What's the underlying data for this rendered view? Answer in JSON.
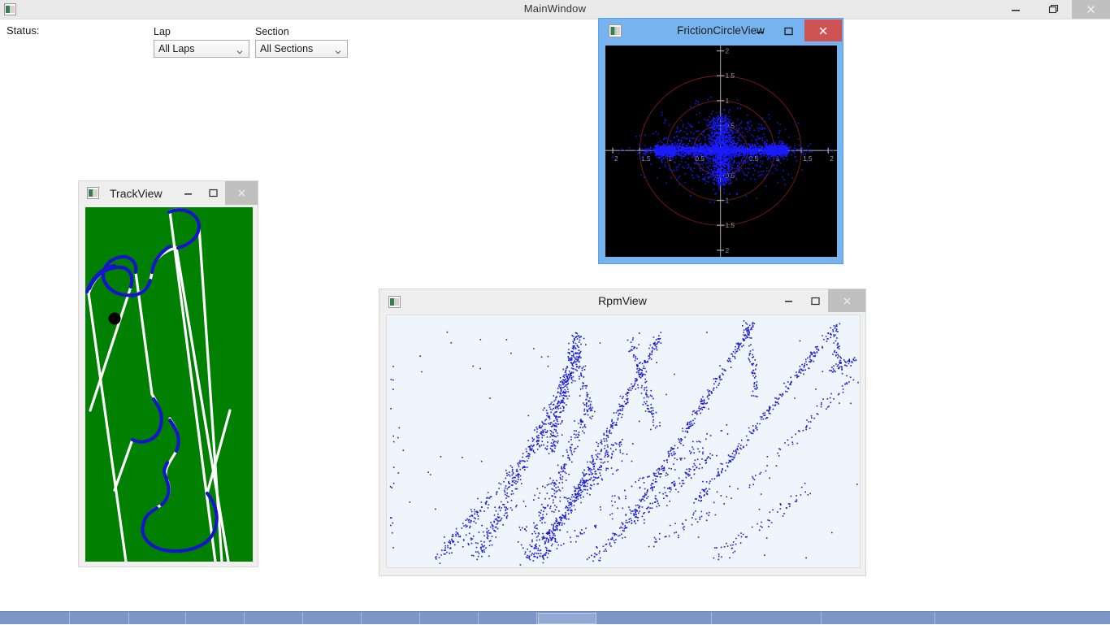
{
  "main_window": {
    "title": "MainWindow",
    "icon": "app-icon",
    "controls": {
      "minimize": "–",
      "maximize": "❐",
      "close": "×"
    }
  },
  "toolbar": {
    "status_label": "Status:",
    "status_value": "",
    "lap_filter": {
      "label": "Lap",
      "value": "All Laps",
      "options": [
        "All Laps"
      ]
    },
    "section_filter": {
      "label": "Section",
      "value": "All Sections",
      "options": [
        "All Sections"
      ]
    }
  },
  "windows": {
    "friction_circle": {
      "title": "FrictionCircleView",
      "icon": "app-icon",
      "active": true,
      "controls": {
        "minimize": "–",
        "maximize": "❐",
        "close": "×"
      },
      "colors": {
        "frame": "#76b3ef",
        "plot_background": "#000000",
        "axis": "#9a9a9a",
        "circle": "#7a1a1a",
        "points": "#1a1aff",
        "labels": "#9a9a9a"
      }
    },
    "track": {
      "title": "TrackView",
      "icon": "app-icon",
      "active": false,
      "controls": {
        "minimize": "–",
        "maximize": "❐",
        "close": "×"
      },
      "colors": {
        "grass": "#008000",
        "track_line": "#ffffff",
        "corner_line": "#1616c8",
        "marker": "#000000"
      }
    },
    "rpm": {
      "title": "RpmView",
      "icon": "app-icon",
      "active": false,
      "controls": {
        "minimize": "–",
        "maximize": "❐",
        "close": "×"
      },
      "colors": {
        "plot_background": "#eff5fc",
        "points": "#1a1ad0"
      }
    }
  },
  "chart_data": [
    {
      "id": "friction-circle",
      "type": "scatter",
      "title": "FrictionCircleView",
      "xlabel": "",
      "ylabel": "",
      "xlim": [
        -2.15,
        2.15
      ],
      "ylim": [
        -2.15,
        2.15
      ],
      "xticks": [
        -2,
        -1.5,
        -1,
        -0.5,
        0.5,
        1,
        1.5,
        2
      ],
      "xtick_labels": [
        "2",
        "1.5",
        "1",
        "0.5",
        "0.5",
        "1",
        "1.5",
        "2"
      ],
      "yticks": [
        2,
        1.5,
        1,
        0.5,
        -0.5,
        -1,
        -1.5,
        -2
      ],
      "ytick_labels": [
        "2",
        "1.5",
        "1",
        "0.5",
        "0.5",
        "1",
        "1.5",
        "2"
      ],
      "grid": false,
      "legend": null,
      "reference_circles": [
        0.5,
        1.0,
        1.5
      ],
      "point_color": "#1a1aff",
      "point_size": 1.6,
      "n_points": 4200,
      "description": "Lateral vs longitudinal acceleration (g) friction circle; dense horizontal band near +/-1.2 g lateral, vertical spine to +/-0.7 g longitudinal."
    },
    {
      "id": "rpm-trace",
      "type": "scatter",
      "title": "RpmView",
      "xlabel": "",
      "ylabel": "",
      "xlim": [
        0,
        1
      ],
      "ylim": [
        0,
        1
      ],
      "xticks": [],
      "yticks": [],
      "grid": false,
      "legend": null,
      "point_color": "#1a1ad0",
      "point_size": 1.6,
      "n_points": 2600,
      "description": "Engine RPM vs speed/distance; rising diagonal ramps terminated by sharp drops (gear shifts), forming a sawtooth family of lines."
    },
    {
      "id": "track-map",
      "type": "line",
      "title": "TrackView",
      "xlim": [
        0,
        206
      ],
      "ylim": [
        0,
        436
      ],
      "grid": false,
      "legend": null,
      "description": "Circuit centre-line map drawn on green infield. White straights, blue-highlighted corner segments, black dot marks current car position.",
      "marker_position": [
        36,
        137
      ]
    }
  ]
}
